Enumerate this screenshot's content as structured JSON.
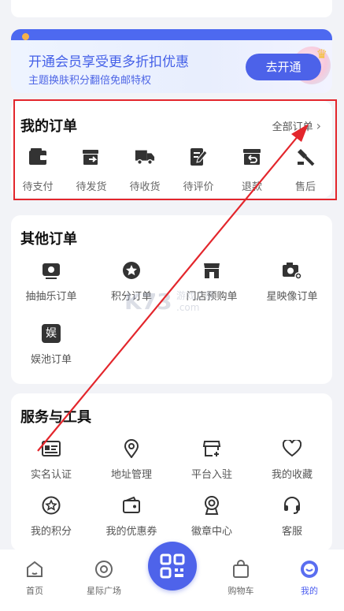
{
  "member": {
    "title": "开通会员享受更多折扣优惠",
    "subtitle": "主题换肤积分翻倍免邮特权",
    "button": "去开通"
  },
  "my_orders": {
    "title": "我的订单",
    "all_link": "全部订单",
    "items": [
      {
        "label": "待支付",
        "icon": "wallet-icon"
      },
      {
        "label": "待发货",
        "icon": "package-send-icon"
      },
      {
        "label": "待收货",
        "icon": "truck-icon"
      },
      {
        "label": "待评价",
        "icon": "edit-note-icon"
      },
      {
        "label": "退款",
        "icon": "refund-icon"
      },
      {
        "label": "售后",
        "icon": "hammer-icon"
      }
    ]
  },
  "other_orders": {
    "title": "其他订单",
    "items": [
      {
        "label": "抽抽乐订单",
        "icon": "lottery-icon"
      },
      {
        "label": "积分订单",
        "icon": "star-points-icon"
      },
      {
        "label": "门店预购单",
        "icon": "store-icon"
      },
      {
        "label": "星映像订单",
        "icon": "camera-icon"
      },
      {
        "label": "娱池订单",
        "icon": "entertainment-icon",
        "glyph": "娱"
      }
    ]
  },
  "services": {
    "title": "服务与工具",
    "items": [
      {
        "label": "实名认证",
        "icon": "id-card-icon"
      },
      {
        "label": "地址管理",
        "icon": "location-pin-icon"
      },
      {
        "label": "平台入驻",
        "icon": "shop-join-icon"
      },
      {
        "label": "我的收藏",
        "icon": "heart-icon"
      },
      {
        "label": "我的积分",
        "icon": "star-circle-icon"
      },
      {
        "label": "我的优惠券",
        "icon": "coupon-icon"
      },
      {
        "label": "徽章中心",
        "icon": "badge-icon"
      },
      {
        "label": "客服",
        "icon": "headset-icon"
      }
    ]
  },
  "watermark": {
    "logo": "K73",
    "line1": "游戏之家",
    "line2": ".com"
  },
  "tabbar": {
    "items": [
      {
        "label": "首页",
        "icon": "home-icon"
      },
      {
        "label": "星际广场",
        "icon": "planet-icon"
      },
      {
        "label": "购物车",
        "icon": "cart-icon"
      },
      {
        "label": "我的",
        "icon": "profile-icon",
        "active": true
      }
    ],
    "center_icon": "qr-scan-icon"
  },
  "colors": {
    "accent": "#4c62e9",
    "annotation": "#e3262c",
    "background": "#f2f3f7"
  }
}
